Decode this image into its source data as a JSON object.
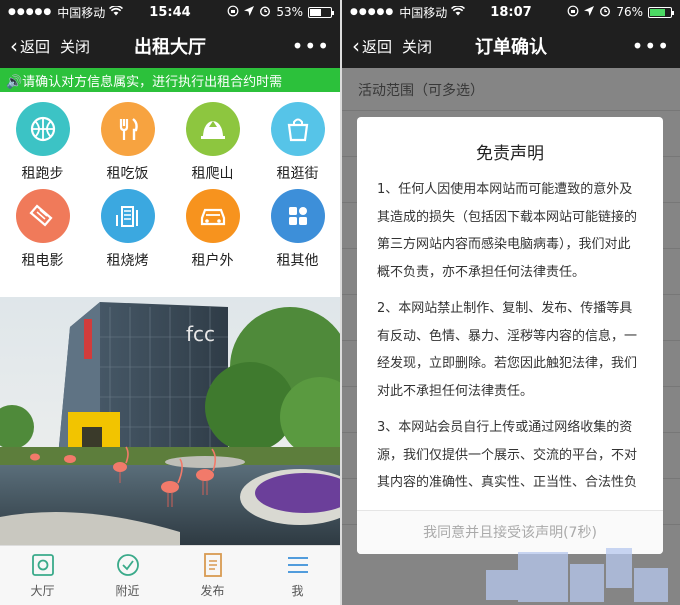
{
  "left": {
    "status": {
      "dots": "●●●●●",
      "carrier": "中国移动",
      "time": "15:44",
      "battery": "53%",
      "battery_level": 0.53
    },
    "nav": {
      "back": "返回",
      "close": "关闭",
      "title": "出租大厅",
      "more": "•••"
    },
    "marquee": "🔊请确认对方信息属实，进行执行出租合约时需",
    "categories": [
      {
        "label": "租跑步",
        "icon": "basketball-icon",
        "color": "#3cc3c5"
      },
      {
        "label": "租吃饭",
        "icon": "fork-knife-icon",
        "color": "#f7a340"
      },
      {
        "label": "租爬山",
        "icon": "mountain-icon",
        "color": "#8dc63f"
      },
      {
        "label": "租逛街",
        "icon": "shopping-bag-icon",
        "color": "#56c4e8"
      },
      {
        "label": "租电影",
        "icon": "ticket-icon",
        "color": "#f07a5a"
      },
      {
        "label": "租烧烤",
        "icon": "grill-icon",
        "color": "#3ba8e0"
      },
      {
        "label": "租户外",
        "icon": "car-icon",
        "color": "#f7931e"
      },
      {
        "label": "租其他",
        "icon": "grid-icon",
        "color": "#3d8fd9"
      }
    ],
    "tabs": [
      {
        "label": "大厅",
        "icon": "hall-icon"
      },
      {
        "label": "附近",
        "icon": "check-circle-icon"
      },
      {
        "label": "发布",
        "icon": "publish-icon"
      },
      {
        "label": "我",
        "icon": "menu-icon"
      }
    ],
    "photo_sign": "fcc"
  },
  "right": {
    "status": {
      "dots": "●●●●●",
      "carrier": "中国移动",
      "time": "18:07",
      "battery": "76%",
      "battery_level": 0.76
    },
    "nav": {
      "back": "返回",
      "close": "关闭",
      "title": "订单确认",
      "more": "•••"
    },
    "section": "活动范围（可多选）",
    "dialog": {
      "title": "免责声明",
      "paragraphs": [
        "1、任何人因使用本网站而可能遭致的意外及其造成的损失（包括因下载本网站可能链接的第三方网站内容而感染电脑病毒），我们对此概不负责，亦不承担任何法律责任。",
        "2、本网站禁止制作、复制、发布、传播等具有反动、色情、暴力、淫秽等内容的信息，一经发现，立即删除。若您因此触犯法律，我们对此不承担任何法律责任。",
        "3、本网站会员自行上传或通过网络收集的资源，我们仅提供一个展示、交流的平台，不对其内容的准确性、真实性、正当性、合法性负"
      ],
      "agree": "我同意并且接受该声明(7秒)"
    }
  }
}
